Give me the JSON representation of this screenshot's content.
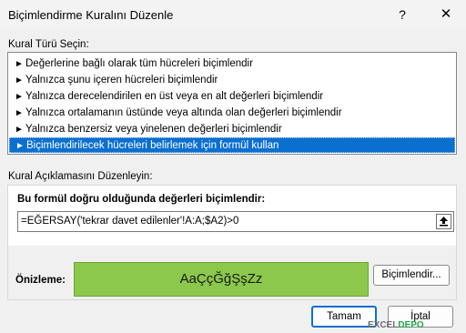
{
  "window": {
    "title": "Biçimlendirme Kuralını Düzenle",
    "help_glyph": "?",
    "close_glyph": "✕"
  },
  "rule_type": {
    "label": "Kural Türü Seçin:",
    "items": [
      "Değerlerine bağlı olarak tüm hücreleri biçimlendir",
      "Yalnızca şunu içeren hücreleri biçimlendir",
      "Yalnızca derecelendirilen en üst veya en alt değerleri biçimlendir",
      "Yalnızca ortalamanın üstünde veya altında olan değerleri biçimlendir",
      "Yalnızca benzersiz veya yinelenen değerleri biçimlendir",
      "Biçimlendirilecek hücreleri belirlemek için formül kullan"
    ],
    "selected_index": 5,
    "item_icon": "triangle-arrow-right-icon"
  },
  "description": {
    "label": "Kural Açıklamasını Düzenleyin:",
    "formula_heading": "Bu formül doğru olduğunda değerleri biçimlendir:",
    "formula_value": "=EĞERSAY('tekrar davet edilenler'!A:A;$A2)>0",
    "preview_label": "Önizleme:",
    "preview_text": "AaÇçĞğŞşZz",
    "preview_fill": "#8cc84b",
    "format_button": "Biçimlendir..."
  },
  "buttons": {
    "ok": "Tamam",
    "cancel": "İptal"
  },
  "watermark": {
    "part1": "EXCEL",
    "part2": "DEPO"
  },
  "colors": {
    "accent": "#0b6fd0",
    "selection_bg": "#0b6fd0"
  }
}
